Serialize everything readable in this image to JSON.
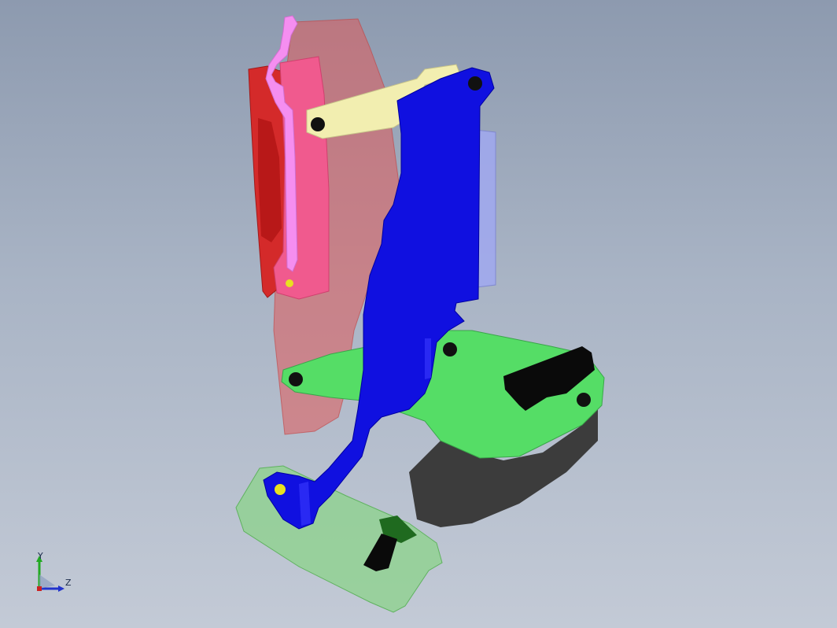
{
  "viewport": {
    "background_top": "#8d9aaf",
    "background_bottom": "#c3cad6"
  },
  "parts": {
    "red_housing": {
      "color": "#d42a2a"
    },
    "pink_plate": {
      "color": "#f05a8e"
    },
    "magenta_hook": {
      "color": "#f58ef0"
    },
    "red_translucent_panel": {
      "color": "#e05a5a"
    },
    "blue_arm": {
      "color": "#1010e0"
    },
    "light_blue_plate": {
      "color": "#a0a8f0"
    },
    "yellow_link": {
      "color": "#f2eeb0"
    },
    "green_base": {
      "color": "#55dd66"
    },
    "light_green_block": {
      "color": "#8fd28f"
    },
    "dark_grey_body": {
      "color": "#3c3c3c"
    },
    "black_handle": {
      "color": "#0a0a0a"
    },
    "black_knob": {
      "color": "#0a0a0a"
    },
    "dark_green_cap": {
      "color": "#1f6a1f"
    },
    "yellow_pin": {
      "color": "#e8e020"
    }
  },
  "triad": {
    "y_label": "Y",
    "z_label": "Z"
  }
}
